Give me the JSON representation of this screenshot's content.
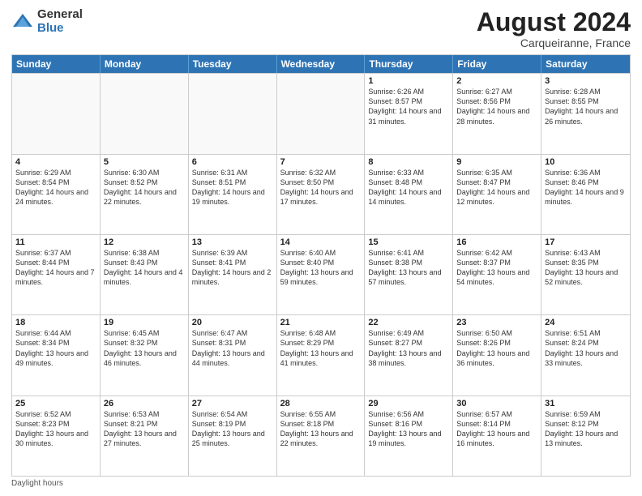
{
  "logo": {
    "general": "General",
    "blue": "Blue"
  },
  "title": "August 2024",
  "subtitle": "Carqueiranne, France",
  "days_of_week": [
    "Sunday",
    "Monday",
    "Tuesday",
    "Wednesday",
    "Thursday",
    "Friday",
    "Saturday"
  ],
  "footer": "Daylight hours",
  "weeks": [
    [
      {
        "day": "",
        "info": ""
      },
      {
        "day": "",
        "info": ""
      },
      {
        "day": "",
        "info": ""
      },
      {
        "day": "",
        "info": ""
      },
      {
        "day": "1",
        "info": "Sunrise: 6:26 AM\nSunset: 8:57 PM\nDaylight: 14 hours and 31 minutes."
      },
      {
        "day": "2",
        "info": "Sunrise: 6:27 AM\nSunset: 8:56 PM\nDaylight: 14 hours and 28 minutes."
      },
      {
        "day": "3",
        "info": "Sunrise: 6:28 AM\nSunset: 8:55 PM\nDaylight: 14 hours and 26 minutes."
      }
    ],
    [
      {
        "day": "4",
        "info": "Sunrise: 6:29 AM\nSunset: 8:54 PM\nDaylight: 14 hours and 24 minutes."
      },
      {
        "day": "5",
        "info": "Sunrise: 6:30 AM\nSunset: 8:52 PM\nDaylight: 14 hours and 22 minutes."
      },
      {
        "day": "6",
        "info": "Sunrise: 6:31 AM\nSunset: 8:51 PM\nDaylight: 14 hours and 19 minutes."
      },
      {
        "day": "7",
        "info": "Sunrise: 6:32 AM\nSunset: 8:50 PM\nDaylight: 14 hours and 17 minutes."
      },
      {
        "day": "8",
        "info": "Sunrise: 6:33 AM\nSunset: 8:48 PM\nDaylight: 14 hours and 14 minutes."
      },
      {
        "day": "9",
        "info": "Sunrise: 6:35 AM\nSunset: 8:47 PM\nDaylight: 14 hours and 12 minutes."
      },
      {
        "day": "10",
        "info": "Sunrise: 6:36 AM\nSunset: 8:46 PM\nDaylight: 14 hours and 9 minutes."
      }
    ],
    [
      {
        "day": "11",
        "info": "Sunrise: 6:37 AM\nSunset: 8:44 PM\nDaylight: 14 hours and 7 minutes."
      },
      {
        "day": "12",
        "info": "Sunrise: 6:38 AM\nSunset: 8:43 PM\nDaylight: 14 hours and 4 minutes."
      },
      {
        "day": "13",
        "info": "Sunrise: 6:39 AM\nSunset: 8:41 PM\nDaylight: 14 hours and 2 minutes."
      },
      {
        "day": "14",
        "info": "Sunrise: 6:40 AM\nSunset: 8:40 PM\nDaylight: 13 hours and 59 minutes."
      },
      {
        "day": "15",
        "info": "Sunrise: 6:41 AM\nSunset: 8:38 PM\nDaylight: 13 hours and 57 minutes."
      },
      {
        "day": "16",
        "info": "Sunrise: 6:42 AM\nSunset: 8:37 PM\nDaylight: 13 hours and 54 minutes."
      },
      {
        "day": "17",
        "info": "Sunrise: 6:43 AM\nSunset: 8:35 PM\nDaylight: 13 hours and 52 minutes."
      }
    ],
    [
      {
        "day": "18",
        "info": "Sunrise: 6:44 AM\nSunset: 8:34 PM\nDaylight: 13 hours and 49 minutes."
      },
      {
        "day": "19",
        "info": "Sunrise: 6:45 AM\nSunset: 8:32 PM\nDaylight: 13 hours and 46 minutes."
      },
      {
        "day": "20",
        "info": "Sunrise: 6:47 AM\nSunset: 8:31 PM\nDaylight: 13 hours and 44 minutes."
      },
      {
        "day": "21",
        "info": "Sunrise: 6:48 AM\nSunset: 8:29 PM\nDaylight: 13 hours and 41 minutes."
      },
      {
        "day": "22",
        "info": "Sunrise: 6:49 AM\nSunset: 8:27 PM\nDaylight: 13 hours and 38 minutes."
      },
      {
        "day": "23",
        "info": "Sunrise: 6:50 AM\nSunset: 8:26 PM\nDaylight: 13 hours and 36 minutes."
      },
      {
        "day": "24",
        "info": "Sunrise: 6:51 AM\nSunset: 8:24 PM\nDaylight: 13 hours and 33 minutes."
      }
    ],
    [
      {
        "day": "25",
        "info": "Sunrise: 6:52 AM\nSunset: 8:23 PM\nDaylight: 13 hours and 30 minutes."
      },
      {
        "day": "26",
        "info": "Sunrise: 6:53 AM\nSunset: 8:21 PM\nDaylight: 13 hours and 27 minutes."
      },
      {
        "day": "27",
        "info": "Sunrise: 6:54 AM\nSunset: 8:19 PM\nDaylight: 13 hours and 25 minutes."
      },
      {
        "day": "28",
        "info": "Sunrise: 6:55 AM\nSunset: 8:18 PM\nDaylight: 13 hours and 22 minutes."
      },
      {
        "day": "29",
        "info": "Sunrise: 6:56 AM\nSunset: 8:16 PM\nDaylight: 13 hours and 19 minutes."
      },
      {
        "day": "30",
        "info": "Sunrise: 6:57 AM\nSunset: 8:14 PM\nDaylight: 13 hours and 16 minutes."
      },
      {
        "day": "31",
        "info": "Sunrise: 6:59 AM\nSunset: 8:12 PM\nDaylight: 13 hours and 13 minutes."
      }
    ]
  ]
}
